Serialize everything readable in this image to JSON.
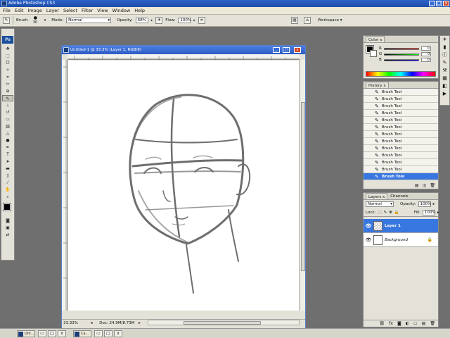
{
  "app": {
    "title": "Adobe Photoshop CS3",
    "logo": "Ps"
  },
  "window_buttons": {
    "minimize": "_",
    "maximize": "□",
    "close": "x"
  },
  "menu": [
    "File",
    "Edit",
    "Image",
    "Layer",
    "Select",
    "Filter",
    "View",
    "Window",
    "Help"
  ],
  "options_bar": {
    "brush_label": "Brush:",
    "brush_size": "30",
    "mode_label": "Mode:",
    "mode_value": "Normal",
    "opacity_label": "Opacity:",
    "opacity_value": "68%",
    "flow_label": "Flow:",
    "flow_value": "100%",
    "workspace_label": "Workspace"
  },
  "document": {
    "title": "Untitled-1 @ 33.3% (Layer 1, RGB/8)",
    "zoom": "33.33%",
    "doc_size": "Doc: 24.9M/8.73M"
  },
  "color_panel": {
    "tab": "Color",
    "channels": [
      {
        "label": "R",
        "value": "0"
      },
      {
        "label": "G",
        "value": "0"
      },
      {
        "label": "B",
        "value": "0"
      }
    ]
  },
  "history_panel": {
    "tab": "History",
    "items": [
      "Brush Tool",
      "Brush Tool",
      "Brush Tool",
      "Brush Tool",
      "Brush Tool",
      "Brush Tool",
      "Brush Tool",
      "Brush Tool",
      "Brush Tool",
      "Brush Tool",
      "Brush Tool",
      "Brush Tool",
      "Brush Tool"
    ],
    "selected_index": 12
  },
  "layers_panel": {
    "tabs": [
      "Layers",
      "Channels"
    ],
    "blend_mode": "Normal",
    "opacity_label": "Opacity:",
    "opacity_value": "100%",
    "lock_label": "Lock:",
    "fill_label": "Fill:",
    "fill_value": "100%",
    "layers": [
      {
        "name": "Layer 1",
        "selected": true
      },
      {
        "name": "Background",
        "selected": false
      }
    ]
  },
  "taskbar": {
    "items": [
      "Unt...",
      "Ca..."
    ]
  },
  "colors": {
    "accent_selection": "#3877e0",
    "titlebar": "#2b62c9"
  }
}
